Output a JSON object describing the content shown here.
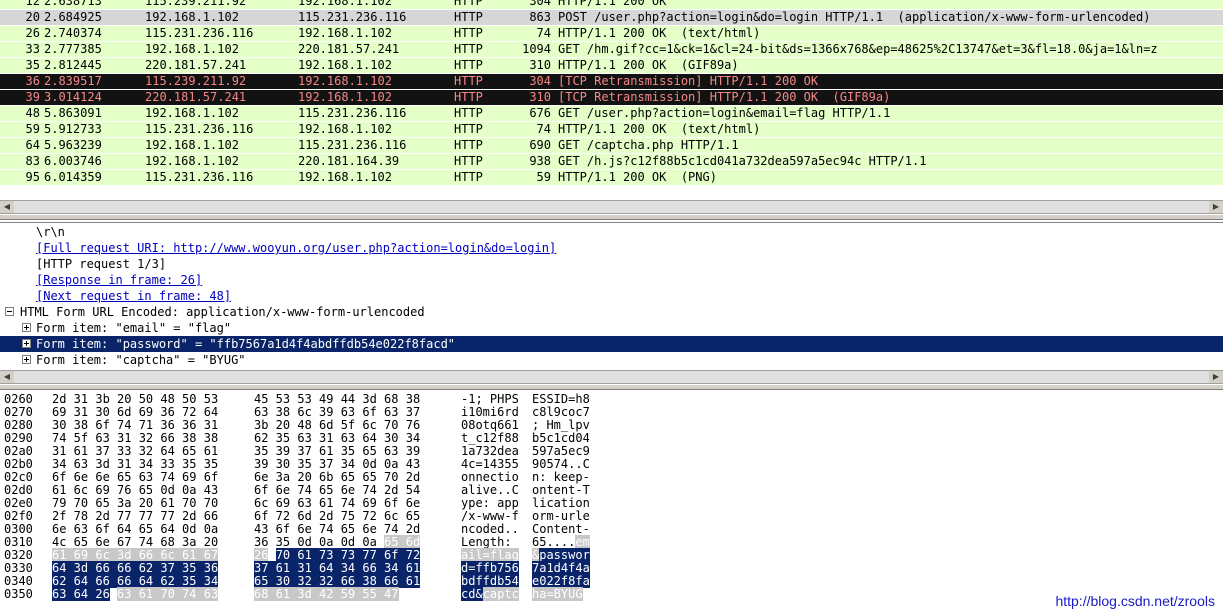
{
  "colors": {
    "http_row": "#e4ffc7",
    "post_row": "#d6d6d6",
    "retrans_row": "#121212",
    "retrans_text": "#f78787",
    "selection": "#0a246a",
    "hex_grey": "#c8c8c8"
  },
  "packets": [
    {
      "no": "12",
      "time": "2.638713",
      "src": "115.239.211.92",
      "dst": "192.168.1.102",
      "proto": "HTTP",
      "len": "304",
      "info": "HTTP/1.1 200 OK",
      "style": "http"
    },
    {
      "no": "20",
      "time": "2.684925",
      "src": "192.168.1.102",
      "dst": "115.231.236.116",
      "proto": "HTTP",
      "len": "863",
      "info": "POST /user.php?action=login&do=login HTTP/1.1  (application/x-www-form-urlencoded)",
      "style": "post"
    },
    {
      "no": "26",
      "time": "2.740374",
      "src": "115.231.236.116",
      "dst": "192.168.1.102",
      "proto": "HTTP",
      "len": "74",
      "info": "HTTP/1.1 200 OK  (text/html)",
      "style": "http"
    },
    {
      "no": "33",
      "time": "2.777385",
      "src": "192.168.1.102",
      "dst": "220.181.57.241",
      "proto": "HTTP",
      "len": "1094",
      "info": "GET /hm.gif?cc=1&ck=1&cl=24-bit&ds=1366x768&ep=48625%2C13747&et=3&fl=18.0&ja=1&ln=z",
      "style": "http"
    },
    {
      "no": "35",
      "time": "2.812445",
      "src": "220.181.57.241",
      "dst": "192.168.1.102",
      "proto": "HTTP",
      "len": "310",
      "info": "HTTP/1.1 200 OK  (GIF89a)",
      "style": "http"
    },
    {
      "no": "36",
      "time": "2.839517",
      "src": "115.239.211.92",
      "dst": "192.168.1.102",
      "proto": "HTTP",
      "len": "304",
      "info": "[TCP Retransmission] HTTP/1.1 200 OK",
      "style": "retrans"
    },
    {
      "no": "39",
      "time": "3.014124",
      "src": "220.181.57.241",
      "dst": "192.168.1.102",
      "proto": "HTTP",
      "len": "310",
      "info": "[TCP Retransmission] HTTP/1.1 200 OK  (GIF89a)",
      "style": "retrans"
    },
    {
      "no": "48",
      "time": "5.863091",
      "src": "192.168.1.102",
      "dst": "115.231.236.116",
      "proto": "HTTP",
      "len": "676",
      "info": "GET /user.php?action=login&email=flag HTTP/1.1",
      "style": "http"
    },
    {
      "no": "59",
      "time": "5.912733",
      "src": "115.231.236.116",
      "dst": "192.168.1.102",
      "proto": "HTTP",
      "len": "74",
      "info": "HTTP/1.1 200 OK  (text/html)",
      "style": "http"
    },
    {
      "no": "64",
      "time": "5.963239",
      "src": "192.168.1.102",
      "dst": "115.231.236.116",
      "proto": "HTTP",
      "len": "690",
      "info": "GET /captcha.php HTTP/1.1",
      "style": "http"
    },
    {
      "no": "83",
      "time": "6.003746",
      "src": "192.168.1.102",
      "dst": "220.181.164.39",
      "proto": "HTTP",
      "len": "938",
      "info": "GET /h.js?c12f88b5c1cd041a732dea597a5ec94c HTTP/1.1",
      "style": "http"
    },
    {
      "no": "95",
      "time": "6.014359",
      "src": "115.231.236.116",
      "dst": "192.168.1.102",
      "proto": "HTTP",
      "len": "59",
      "info": "HTTP/1.1 200 OK  (PNG)",
      "style": "http"
    }
  ],
  "details": [
    {
      "text": "\\r\\n",
      "indent": 36,
      "type": "plain"
    },
    {
      "text": "[Full request URI: http://www.wooyun.org/user.php?action=login&do=login]",
      "indent": 36,
      "type": "link"
    },
    {
      "text": "[HTTP request 1/3]",
      "indent": 36,
      "type": "plain"
    },
    {
      "text": "[Response in frame: 26]",
      "indent": 36,
      "type": "link"
    },
    {
      "text": "[Next request in frame: 48]",
      "indent": 36,
      "type": "link"
    },
    {
      "text": "HTML Form URL Encoded: application/x-www-form-urlencoded",
      "indent": 20,
      "type": "expanded",
      "exp": 5
    },
    {
      "text": "Form item: \"email\" = \"flag\"",
      "indent": 36,
      "type": "collapsed",
      "exp": 22
    },
    {
      "text": "Form item: \"password\" = \"ffb7567a1d4f4abdffdb54e022f8facd\"",
      "indent": 36,
      "type": "selected",
      "exp": 22
    },
    {
      "text": "Form item: \"captcha\" = \"BYUG\"",
      "indent": 36,
      "type": "collapsed",
      "exp": 22
    }
  ],
  "hex": [
    {
      "off": "0260",
      "a": "2d 31 3b 20 50 48 50 53",
      "b": "45 53 53 49 44 3d 68 38",
      "c": "-1; PHPS",
      "d": "ESSID=h8"
    },
    {
      "off": "0270",
      "a": "69 31 30 6d 69 36 72 64",
      "b": "63 38 6c 39 63 6f 63 37",
      "c": "i10mi6rd",
      "d": "c8l9coc7"
    },
    {
      "off": "0280",
      "a": "30 38 6f 74 71 36 36 31",
      "b": "3b 20 48 6d 5f 6c 70 76",
      "c": "08otq661",
      "d": "; Hm_lpv"
    },
    {
      "off": "0290",
      "a": "74 5f 63 31 32 66 38 38",
      "b": "62 35 63 31 63 64 30 34",
      "c": "t_c12f88",
      "d": "b5c1cd04"
    },
    {
      "off": "02a0",
      "a": "31 61 37 33 32 64 65 61",
      "b": "35 39 37 61 35 65 63 39",
      "c": "1a732dea",
      "d": "597a5ec9"
    },
    {
      "off": "02b0",
      "a": "34 63 3d 31 34 33 35 35",
      "b": "39 30 35 37 34 0d 0a 43",
      "c": "4c=14355",
      "d": "90574..C"
    },
    {
      "off": "02c0",
      "a": "6f 6e 6e 65 63 74 69 6f",
      "b": "6e 3a 20 6b 65 65 70 2d",
      "c": "onnectio",
      "d": "n: keep-"
    },
    {
      "off": "02d0",
      "a": "61 6c 69 76 65 0d 0a 43",
      "b": "6f 6e 74 65 6e 74 2d 54",
      "c": "alive..C",
      "d": "ontent-T"
    },
    {
      "off": "02e0",
      "a": "79 70 65 3a 20 61 70 70",
      "b": "6c 69 63 61 74 69 6f 6e",
      "c": "ype: app",
      "d": "lication"
    },
    {
      "off": "02f0",
      "a": "2f 78 2d 77 77 77 2d 66",
      "b": "6f 72 6d 2d 75 72 6c 65",
      "c": "/x-www-f",
      "d": "orm-urle"
    },
    {
      "off": "0300",
      "a": "6e 63 6f 64 65 64 0d 0a",
      "b": "43 6f 6e 74 65 6e 74 2d",
      "c": "ncoded..",
      "d": "Content-"
    },
    {
      "off": "0310",
      "a": "4c 65 6e 67 74 68 3a 20",
      "b": "36 35 0d 0a 0d 0a 65 6d",
      "c": "Length: ",
      "d": "65....em"
    },
    {
      "off": "0320",
      "a": "61 69 6c 3d 66 6c 61 67",
      "b": "26 70 61 73 73 77 6f 72",
      "c": "ail=flag",
      "d": "&passwor"
    },
    {
      "off": "0330",
      "a": "64 3d 66 66 62 37 35 36",
      "b": "37 61 31 64 34 66 34 61",
      "c": "d=ffb756",
      "d": "7a1d4f4a"
    },
    {
      "off": "0340",
      "a": "62 64 66 66 64 62 35 34",
      "b": "65 30 32 32 66 38 66 61",
      "c": "bdffdb54",
      "d": "e022f8fa"
    },
    {
      "off": "0350",
      "a": "63 64 26 63 61 70 74 63",
      "b": "68 61 3d 42 59 55 47",
      "c": "cd&captc",
      "d": "ha=BYUG"
    }
  ],
  "watermark": "http://blog.csdn.net/zrools"
}
